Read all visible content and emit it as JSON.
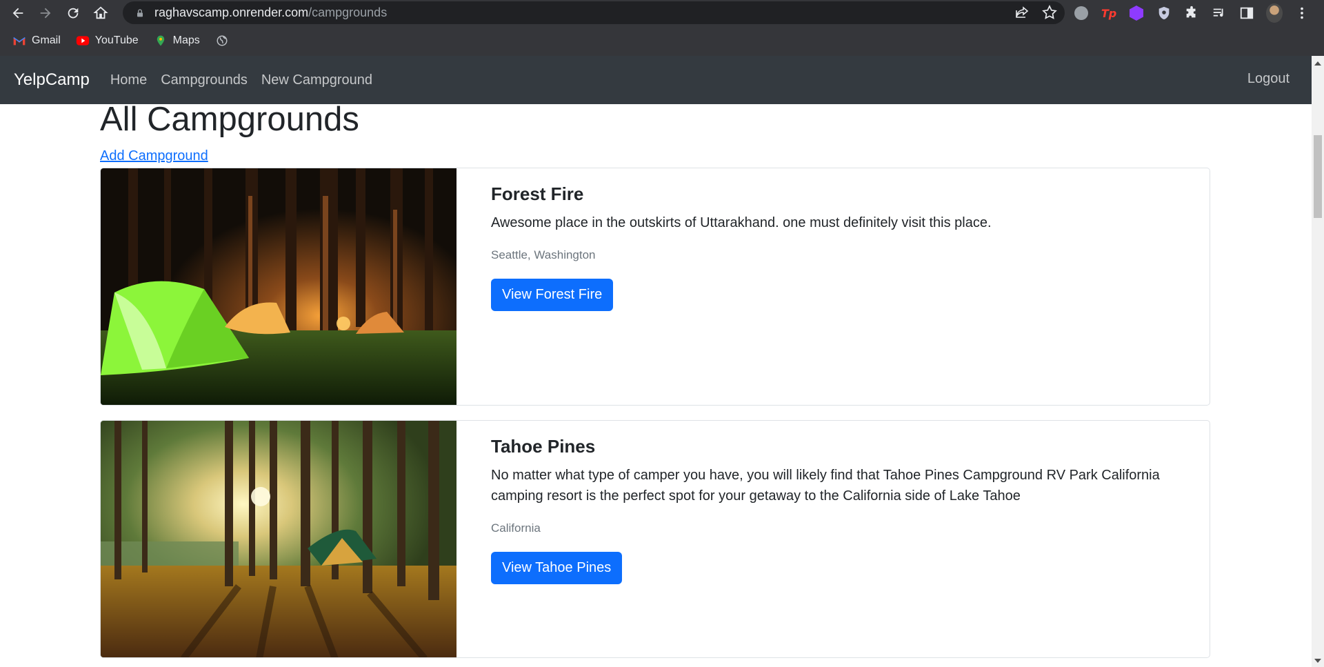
{
  "browser": {
    "url_host": "raghavscamp.onrender.com",
    "url_path": "/campgrounds",
    "bookmarks": [
      {
        "label": "Gmail",
        "icon": "gmail-icon"
      },
      {
        "label": "YouTube",
        "icon": "youtube-icon"
      },
      {
        "label": "Maps",
        "icon": "maps-icon"
      },
      {
        "label": "",
        "icon": "globe-icon"
      }
    ],
    "extensions": [
      "grey-extension-icon",
      "tp-extension-icon",
      "purple-extension-icon",
      "shield-extension-icon",
      "puzzle-icon",
      "media-queue-icon",
      "side-panel-icon",
      "profile-avatar",
      "more-menu-icon"
    ],
    "colors": {
      "chrome_bg": "#35363a",
      "omnibox_bg": "#202124"
    }
  },
  "navbar": {
    "brand": "YelpCamp",
    "links": [
      "Home",
      "Campgrounds",
      "New Campground"
    ],
    "logout": "Logout",
    "bg": "#343a40"
  },
  "main": {
    "title": "All Campgrounds",
    "add_link": "Add Campground",
    "campgrounds": [
      {
        "title": "Forest Fire",
        "description": "Awesome place in the outskirts of Uttarakhand. one must definitely visit this place.",
        "location": "Seattle, Washington",
        "button": "View Forest Fire",
        "image": "night-forest-tents-photo"
      },
      {
        "title": "Tahoe Pines",
        "description": "No matter what type of camper you have, you will likely find that Tahoe Pines Campground RV Park California camping resort is the perfect spot for your getaway to the California side of Lake Tahoe",
        "location": "California",
        "button": "View Tahoe Pines",
        "image": "pine-forest-lake-tent-photo"
      }
    ],
    "accent": "#0d6efd"
  }
}
